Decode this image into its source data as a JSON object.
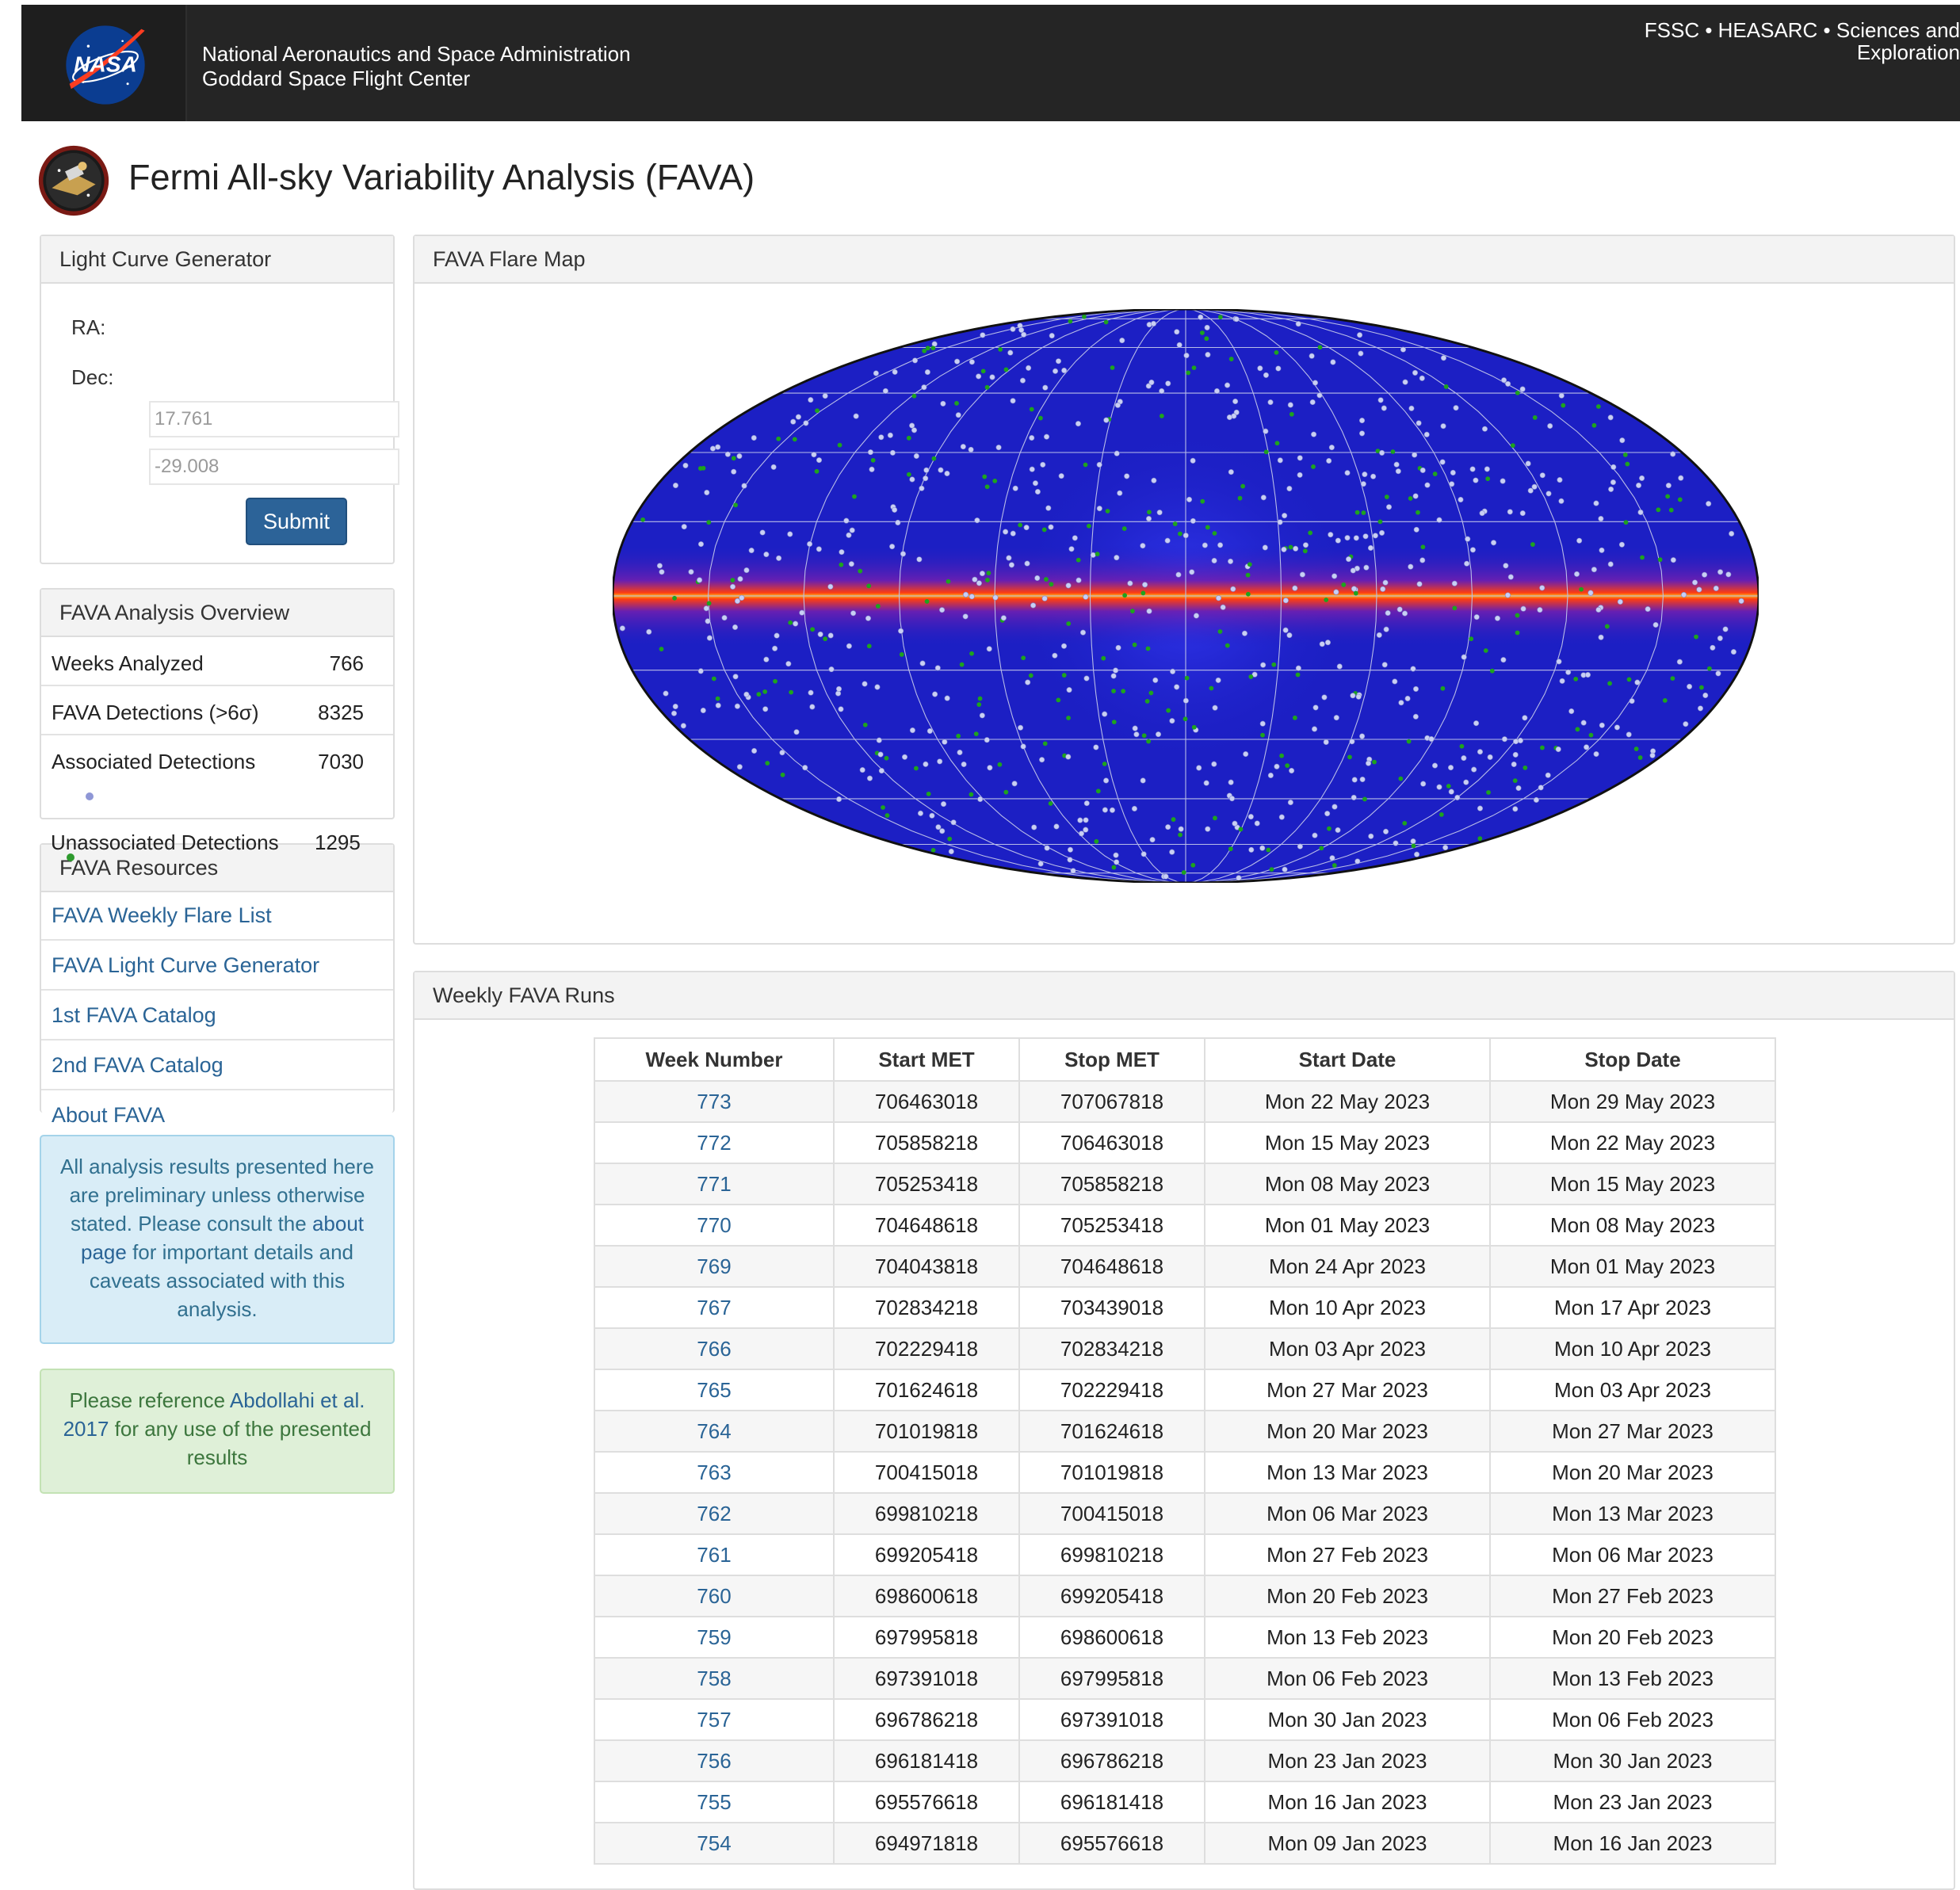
{
  "header": {
    "agency_line1": "National Aeronautics and Space Administration",
    "agency_line2": "Goddard Space Flight Center",
    "links_line1": "FSSC • HEASARC • Sciences and",
    "links_line2": "Exploration",
    "logo_icon": "nasa-meatball-logo"
  },
  "page": {
    "title": "Fermi All-sky Variability Analysis (FAVA)",
    "logo_icon": "fermi-mission-patch"
  },
  "light_curve_generator": {
    "heading": "Light Curve Generator",
    "ra_label": "RA:",
    "dec_label": "Dec:",
    "ra_placeholder": "17.761",
    "dec_placeholder": "-29.008",
    "submit_label": "Submit"
  },
  "overview": {
    "heading": "FAVA Analysis Overview",
    "rows": [
      {
        "label": "Weeks Analyzed",
        "value": "766"
      },
      {
        "label": "FAVA Detections (>6σ)",
        "value": "8325"
      },
      {
        "label": "Associated Detections",
        "value": "7030"
      },
      {
        "label": "Unassociated Detections",
        "value": "1295"
      }
    ],
    "associated_marker_color": "#8f97d6",
    "unassociated_marker_color": "#2e9a2e"
  },
  "resources": {
    "heading": "FAVA Resources",
    "items": [
      "FAVA Weekly Flare List",
      "FAVA Light Curve Generator",
      "1st FAVA Catalog",
      "2nd FAVA Catalog",
      "About FAVA"
    ]
  },
  "notices": {
    "blue_pre": "All analysis results presented here are preliminary unless otherwise stated. Please consult the ",
    "blue_link": "about page",
    "blue_post": " for important details and caveats associated with this analysis.",
    "green_pre": "Please reference ",
    "green_link": "Abdollahi et al. 2017",
    "green_post": " for any use of the presented results"
  },
  "flare_map": {
    "heading": "FAVA Flare Map",
    "colors": {
      "sky": "#1c1fc4",
      "plane_core": "#ff5a12",
      "plane_glow": "#e0262c",
      "associated": "#c9cff5",
      "unassociated": "#1ea31e"
    }
  },
  "weekly_runs": {
    "heading": "Weekly FAVA Runs",
    "columns": [
      "Week Number",
      "Start MET",
      "Stop MET",
      "Start Date",
      "Stop Date"
    ],
    "rows": [
      [
        "773",
        "706463018",
        "707067818",
        "Mon 22 May 2023",
        "Mon 29 May 2023"
      ],
      [
        "772",
        "705858218",
        "706463018",
        "Mon 15 May 2023",
        "Mon 22 May 2023"
      ],
      [
        "771",
        "705253418",
        "705858218",
        "Mon 08 May 2023",
        "Mon 15 May 2023"
      ],
      [
        "770",
        "704648618",
        "705253418",
        "Mon 01 May 2023",
        "Mon 08 May 2023"
      ],
      [
        "769",
        "704043818",
        "704648618",
        "Mon 24 Apr 2023",
        "Mon 01 May 2023"
      ],
      [
        "767",
        "702834218",
        "703439018",
        "Mon 10 Apr 2023",
        "Mon 17 Apr 2023"
      ],
      [
        "766",
        "702229418",
        "702834218",
        "Mon 03 Apr 2023",
        "Mon 10 Apr 2023"
      ],
      [
        "765",
        "701624618",
        "702229418",
        "Mon 27 Mar 2023",
        "Mon 03 Apr 2023"
      ],
      [
        "764",
        "701019818",
        "701624618",
        "Mon 20 Mar 2023",
        "Mon 27 Mar 2023"
      ],
      [
        "763",
        "700415018",
        "701019818",
        "Mon 13 Mar 2023",
        "Mon 20 Mar 2023"
      ],
      [
        "762",
        "699810218",
        "700415018",
        "Mon 06 Mar 2023",
        "Mon 13 Mar 2023"
      ],
      [
        "761",
        "699205418",
        "699810218",
        "Mon 27 Feb 2023",
        "Mon 06 Mar 2023"
      ],
      [
        "760",
        "698600618",
        "699205418",
        "Mon 20 Feb 2023",
        "Mon 27 Feb 2023"
      ],
      [
        "759",
        "697995818",
        "698600618",
        "Mon 13 Feb 2023",
        "Mon 20 Feb 2023"
      ],
      [
        "758",
        "697391018",
        "697995818",
        "Mon 06 Feb 2023",
        "Mon 13 Feb 2023"
      ],
      [
        "757",
        "696786218",
        "697391018",
        "Mon 30 Jan 2023",
        "Mon 06 Feb 2023"
      ],
      [
        "756",
        "696181418",
        "696786218",
        "Mon 23 Jan 2023",
        "Mon 30 Jan 2023"
      ],
      [
        "755",
        "695576618",
        "696181418",
        "Mon 16 Jan 2023",
        "Mon 23 Jan 2023"
      ],
      [
        "754",
        "694971818",
        "695576618",
        "Mon 09 Jan 2023",
        "Mon 16 Jan 2023"
      ]
    ]
  }
}
